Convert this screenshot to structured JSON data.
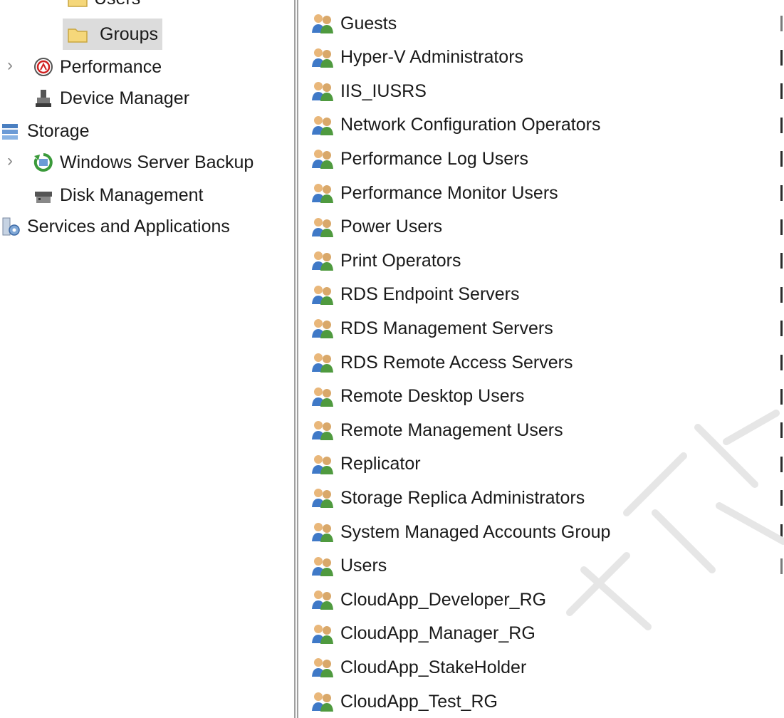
{
  "tree": {
    "items": [
      {
        "label": "Users",
        "icon": "folder-icon"
      },
      {
        "label": "Groups",
        "icon": "folder-icon",
        "selected": true
      },
      {
        "label": "Performance",
        "icon": "performance-icon",
        "expandable": true
      },
      {
        "label": "Device Manager",
        "icon": "device-manager-icon"
      },
      {
        "label": "Storage",
        "icon": "storage-icon"
      },
      {
        "label": "Windows Server Backup",
        "icon": "backup-icon",
        "expandable": true
      },
      {
        "label": "Disk Management",
        "icon": "disk-icon"
      },
      {
        "label": "Services and Applications",
        "icon": "services-icon"
      }
    ]
  },
  "groups": [
    {
      "name": "Guests"
    },
    {
      "name": "Hyper-V Administrators"
    },
    {
      "name": "IIS_IUSRS"
    },
    {
      "name": "Network Configuration Operators"
    },
    {
      "name": "Performance Log Users"
    },
    {
      "name": "Performance Monitor Users"
    },
    {
      "name": "Power Users"
    },
    {
      "name": "Print Operators"
    },
    {
      "name": "RDS Endpoint Servers"
    },
    {
      "name": "RDS Management Servers"
    },
    {
      "name": "RDS Remote Access Servers"
    },
    {
      "name": "Remote Desktop Users"
    },
    {
      "name": "Remote Management Users"
    },
    {
      "name": "Replicator"
    },
    {
      "name": "Storage Replica Administrators"
    },
    {
      "name": "System Managed Accounts Group"
    },
    {
      "name": "Users"
    },
    {
      "name": "CloudApp_Developer_RG"
    },
    {
      "name": "CloudApp_Manager_RG"
    },
    {
      "name": "CloudApp_StakeHolder"
    },
    {
      "name": "CloudApp_Test_RG"
    }
  ],
  "colors": {
    "selection_bg": "#dcdcdc",
    "folder_yellow": "#f5d77a",
    "watermark": "#e8e8e8"
  }
}
